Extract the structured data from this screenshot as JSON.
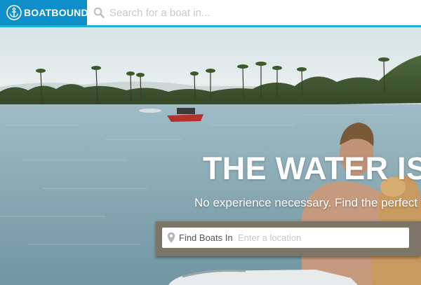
{
  "header": {
    "brand_name": "BOATBOUND",
    "brand_color": "#0f8fc9",
    "accent_color": "#1fb1cf",
    "brand_icon": "anchor-icon",
    "search_icon": "search-icon",
    "search_placeholder": "Search for a boat in..."
  },
  "hero": {
    "title": "THE WATER IS",
    "subtitle": "No experience necessary. Find the perfect bo"
  },
  "location_search": {
    "label": "Find Boats In",
    "placeholder": "Enter a location",
    "icon": "map-pin-icon"
  }
}
